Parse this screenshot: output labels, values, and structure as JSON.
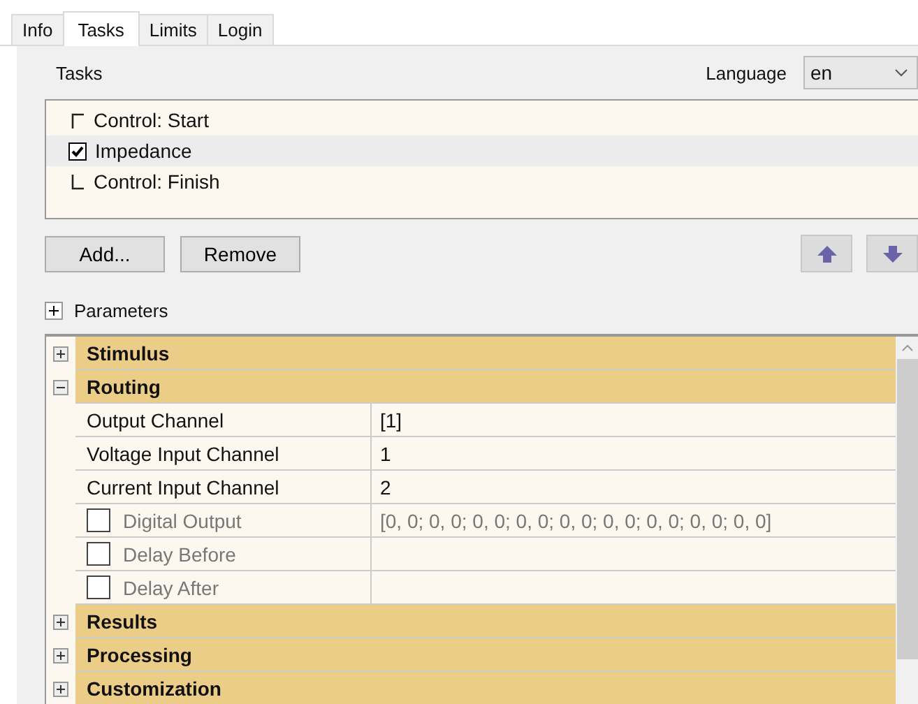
{
  "tabs": [
    {
      "label": "Info",
      "selected": false
    },
    {
      "label": "Tasks",
      "selected": true
    },
    {
      "label": "Limits",
      "selected": false
    },
    {
      "label": "Login",
      "selected": false
    }
  ],
  "tasks_label": "Tasks",
  "language": {
    "label": "Language",
    "value": "en"
  },
  "task_list": [
    {
      "kind": "start",
      "label": "Control: Start",
      "selected": false
    },
    {
      "kind": "task",
      "label": "Impedance",
      "checked": true,
      "selected": true
    },
    {
      "kind": "finish",
      "label": "Control: Finish",
      "selected": false
    }
  ],
  "buttons": [
    "Add...",
    "Remove"
  ],
  "parameters": {
    "label": "Parameters",
    "expanded": false
  },
  "grid": [
    {
      "label": "Stimulus",
      "expanded": false
    },
    {
      "label": "Routing",
      "expanded": true,
      "rows": [
        {
          "kind": "plain",
          "name": "Output Channel",
          "value": "[1]"
        },
        {
          "kind": "plain",
          "name": "Voltage Input Channel",
          "value": "1"
        },
        {
          "kind": "plain",
          "name": "Current Input Channel",
          "value": "2"
        },
        {
          "kind": "optional",
          "name": "Digital Output",
          "value": "[0, 0; 0, 0; 0, 0; 0, 0; 0, 0; 0, 0; 0, 0; 0, 0; 0, 0]",
          "checked": false
        },
        {
          "kind": "optional",
          "name": "Delay Before",
          "checked": false
        },
        {
          "kind": "optional",
          "name": "Delay After",
          "checked": false
        }
      ]
    },
    {
      "label": "Results",
      "expanded": false
    },
    {
      "label": "Processing",
      "expanded": false
    },
    {
      "label": "Customization",
      "expanded": false
    }
  ]
}
